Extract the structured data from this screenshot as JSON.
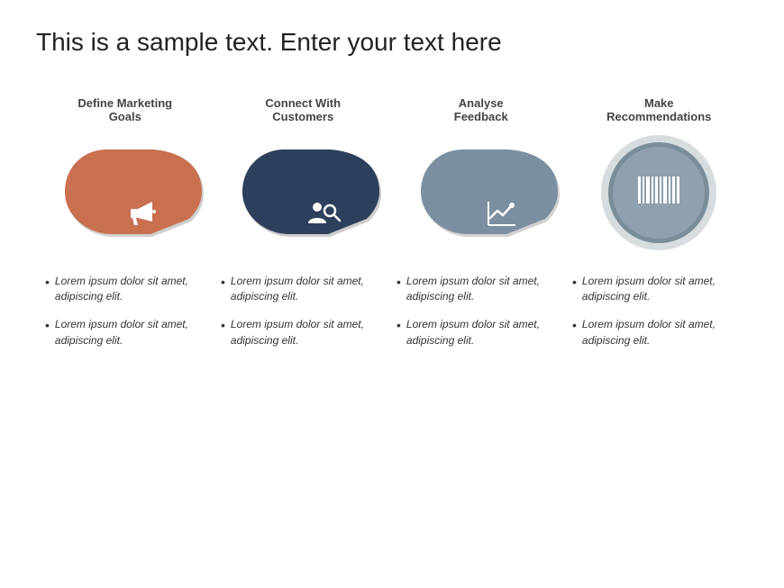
{
  "title": "This is a sample text. Enter your text here",
  "steps": [
    {
      "id": "step-1",
      "label": "Define Marketing\nGoals",
      "color": "#c97050",
      "border_color": "#a05840",
      "icon": "megaphone",
      "shape": "teardrop"
    },
    {
      "id": "step-2",
      "label": "Connect With\nCustomers",
      "color": "#2d3f5a",
      "border_color": "#1e2d42",
      "icon": "people-search",
      "shape": "teardrop"
    },
    {
      "id": "step-3",
      "label": "Analyse\nFeedback",
      "color": "#7b8fa0",
      "border_color": "#5a6e7f",
      "icon": "chart",
      "shape": "teardrop"
    },
    {
      "id": "step-4",
      "label": "Make\nRecommendations",
      "color": "#8fa0ae",
      "border_color": "#6e8090",
      "icon": "barcode",
      "shape": "circle"
    }
  ],
  "bullet_columns": [
    {
      "items": [
        "Lorem ipsum dolor sit amet, adipiscing elit.",
        "Lorem ipsum dolor sit amet, adipiscing elit."
      ]
    },
    {
      "items": [
        "Lorem ipsum dolor sit amet, adipiscing elit.",
        "Lorem ipsum dolor sit amet, adipiscing elit."
      ]
    },
    {
      "items": [
        "Lorem ipsum dolor sit amet, adipiscing elit.",
        "Lorem ipsum dolor sit amet, adipiscing elit."
      ]
    },
    {
      "items": [
        "Lorem ipsum dolor sit amet, adipiscing elit.",
        "Lorem ipsum dolor sit amet, adipiscing elit."
      ]
    }
  ]
}
